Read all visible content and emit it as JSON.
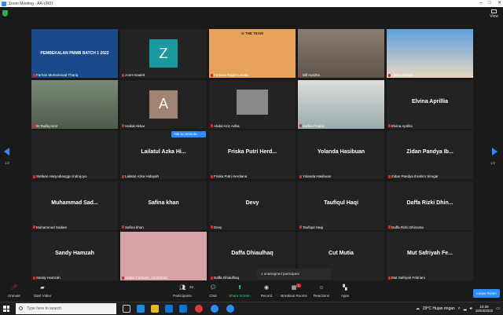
{
  "window": {
    "title": "Zoom Meeting - AA-VR07"
  },
  "topbar": {
    "view_label": "View"
  },
  "pager": {
    "left": "1/2",
    "right": "1/2"
  },
  "tiles": [
    {
      "name": "Farhan Muhammad Thariq",
      "big": "",
      "kind": "video",
      "bg": "#1b4a8c",
      "overlay": "PEMBEKALAN PMMB BATCH 1 2022"
    },
    {
      "name": "zoom Eaa04",
      "big": "",
      "kind": "avatar",
      "bg": "#232323",
      "avatar_letter": "Z",
      "avatar_color": "#1a9aa0"
    },
    {
      "name": "Fortuna Ragil Kumala",
      "big": "",
      "kind": "video",
      "bg": "#e8a35a",
      "overlay": "O THE TEAM"
    },
    {
      "name": "Bill Aurizka",
      "big": "",
      "kind": "video",
      "bg": "#7a6d63",
      "overlay": ""
    },
    {
      "name": "Karina Adinda",
      "big": "",
      "kind": "video",
      "bg": "#3d7bc9",
      "overlay": ""
    },
    {
      "name": "M.Taufiq Amir",
      "big": "",
      "kind": "video",
      "bg": "#6b7a68",
      "overlay": ""
    },
    {
      "name": "Haikal Akbar",
      "big": "",
      "kind": "avatar",
      "bg": "#232323",
      "avatar_letter": "A",
      "avatar_color": "#a08372"
    },
    {
      "name": "Abdul Aziz Adha",
      "big": "",
      "kind": "video",
      "bg": "#232323",
      "overlay": ""
    },
    {
      "name": "Jazkia Pratiwi",
      "big": "",
      "kind": "video",
      "bg": "#b8b8b8",
      "overlay": ""
    },
    {
      "name": "Elvina Aprillia",
      "big": "Elvina Aprillia",
      "kind": "name",
      "bg": "#232323"
    },
    {
      "name": "Stefano Haryodianggo Indrojoyo",
      "big": "",
      "kind": "name",
      "bg": "#232323"
    },
    {
      "name": "Lailatul Azka Hidayah",
      "big": "Lailatul Azka Hi...",
      "kind": "name",
      "bg": "#232323"
    },
    {
      "name": "Friska Putri Herdiana",
      "big": "Friska Putri Herd...",
      "kind": "name",
      "bg": "#232323"
    },
    {
      "name": "Yolanda Hasibuan",
      "big": "Yolanda Hasibuan",
      "kind": "name",
      "bg": "#232323"
    },
    {
      "name": "Zidan Pandya Ibrahim Siregar",
      "big": "Zidan Pandya Ib...",
      "kind": "name",
      "bg": "#232323"
    },
    {
      "name": "Muhammad Sadam",
      "big": "Muhammad Sad...",
      "kind": "name",
      "bg": "#232323"
    },
    {
      "name": "Safina khan",
      "big": "Safina khan",
      "kind": "name",
      "bg": "#232323"
    },
    {
      "name": "Devy",
      "big": "Devy",
      "kind": "name",
      "bg": "#232323"
    },
    {
      "name": "Taufiqul Haqi",
      "big": "Taufiqul Haqi",
      "kind": "name",
      "bg": "#232323"
    },
    {
      "name": "Daffa Rizki Dhinanta",
      "big": "Daffa Rizki Dhin...",
      "kind": "name",
      "bg": "#232323"
    },
    {
      "name": "Sandy Hamzah",
      "big": "Sandy Hamzah",
      "kind": "name",
      "bg": "#232323"
    },
    {
      "name": "Nabila Farhana_1211001D",
      "big": "",
      "kind": "video",
      "bg": "#d9a0a8",
      "overlay": ""
    },
    {
      "name": "Daffa Dhiaulhaq",
      "big": "Daffa Dhiaulhaq",
      "kind": "name",
      "bg": "#232323"
    },
    {
      "name": "",
      "big": "Cut Mutia",
      "kind": "name",
      "bg": "#232323"
    },
    {
      "name": "Mut Safriyah Febriani",
      "big": "Mut Safriyah Fe...",
      "kind": "name",
      "bg": "#232323"
    }
  ],
  "hover": {
    "ask_unmute": "Ask to Unmute",
    "more": "..."
  },
  "toast": {
    "text": "1 unassigned participant"
  },
  "toolbar": {
    "unmute": "Unmute",
    "start_video": "Start Video",
    "participants": "Participants",
    "participants_count": "32",
    "chat": "Chat",
    "share_screen": "Share Screen",
    "record": "Record",
    "breakout": "Breakout Rooms",
    "breakout_badge": "1",
    "reactions": "Reactions",
    "apps": "Apps",
    "leave": "Leave Room"
  },
  "taskbar": {
    "search_placeholder": "Type here to search",
    "weather": "29°C  Hujan ringan",
    "time": "10:38",
    "date": "15/03/2022"
  },
  "colors": {
    "accent": "#2d8cff",
    "active_border": "#c6dc4a",
    "mute_red": "#e02828",
    "share_green": "#2ed573"
  }
}
